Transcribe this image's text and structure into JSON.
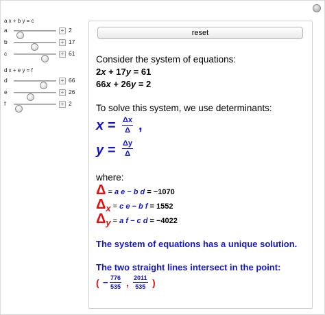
{
  "controls": {
    "eq1_title": "a x + b y = c",
    "eq2_title": "d x + e y = f",
    "sliders": [
      {
        "name": "a",
        "value": "2",
        "fraction": 0.15
      },
      {
        "name": "b",
        "value": "17",
        "fraction": 0.48
      },
      {
        "name": "c",
        "value": "61",
        "fraction": 0.72
      },
      {
        "name": "d",
        "value": "66",
        "fraction": 0.7
      },
      {
        "name": "e",
        "value": "26",
        "fraction": 0.38
      },
      {
        "name": "f",
        "value": "2",
        "fraction": 0.12
      }
    ],
    "plus_icon": "+"
  },
  "panel": {
    "reset_label": "reset",
    "intro": "Consider the system of equations:",
    "equations": [
      {
        "t1": "2",
        "v1": "x",
        "op": " + ",
        "t2": "17",
        "v2": "y",
        "rhs": " = 61"
      },
      {
        "t1": "66",
        "v1": "x",
        "op": " + ",
        "t2": "26",
        "v2": "y",
        "rhs": " = 2"
      }
    ],
    "method_text": "To solve this system, we use determinants:",
    "x_formula": {
      "var": "x",
      "eq": "=",
      "num": "Δx",
      "den": "Δ",
      "trail": ","
    },
    "y_formula": {
      "var": "y",
      "eq": "=",
      "num": "Δy",
      "den": "Δ"
    },
    "where": "where:",
    "determinants": [
      {
        "symbol": "Δ",
        "sub": "",
        "expr": "a e − b d",
        "result": "= −1070"
      },
      {
        "symbol": "Δ",
        "sub": "x",
        "expr": "c e − b f",
        "result": "= 1552"
      },
      {
        "symbol": "Δ",
        "sub": "y",
        "expr": "a f − c d",
        "result": "= −4022"
      }
    ],
    "solution_msg": "The system of equations has a unique solution.",
    "intersect_msg": "The two straight lines intersect in the point:",
    "point": {
      "open": "(",
      "neg": "−",
      "x_num": "776",
      "x_den": "535",
      "comma": ",",
      "y_num": "2011",
      "y_den": "535",
      "close": ")"
    }
  }
}
